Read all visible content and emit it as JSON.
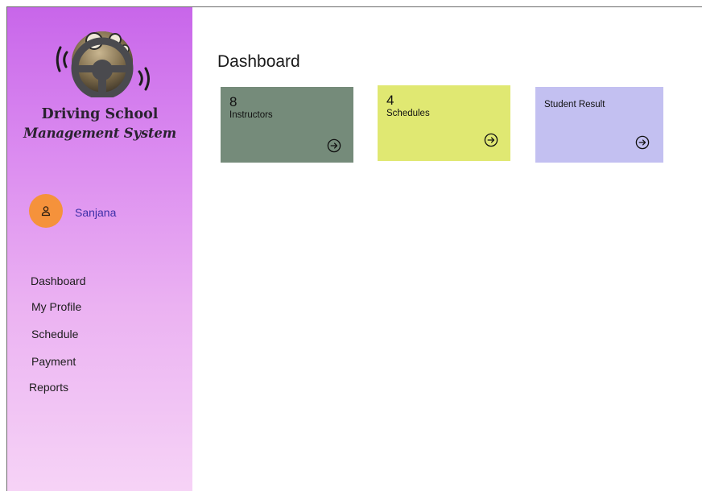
{
  "app": {
    "brand_line1": "Driving School",
    "brand_line2": "Management System",
    "logo_icon": "steering-wheel-logo"
  },
  "user": {
    "name": "Sanjana",
    "avatar_icon": "user-icon",
    "avatar_color": "#f5923b"
  },
  "nav": {
    "items": [
      {
        "label": "Dashboard"
      },
      {
        "label": "My Profile"
      },
      {
        "label": "Schedule"
      },
      {
        "label": "Payment"
      },
      {
        "label": "Reports"
      }
    ]
  },
  "main": {
    "title": "Dashboard",
    "cards": [
      {
        "count": "8",
        "label": "Instructors",
        "color": "#758b7a",
        "icon": "arrow-right-circle-icon"
      },
      {
        "count": "4",
        "label": "Schedules",
        "color": "#e0e872",
        "icon": "arrow-right-circle-icon"
      },
      {
        "count": "",
        "label": "Student Result",
        "color": "#c3c0f1",
        "icon": "arrow-right-circle-icon"
      }
    ]
  },
  "colors": {
    "sidebar_top": "#c866ea",
    "sidebar_bottom": "#f6d3f6",
    "user_name_text": "#3d2fa8"
  }
}
